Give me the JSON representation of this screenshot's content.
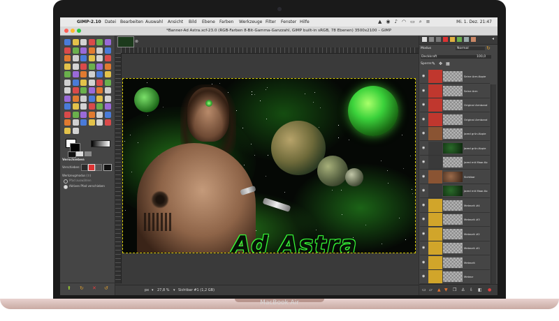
{
  "device": {
    "label": "MacBook Air"
  },
  "menubar": {
    "app_name": "GIMP-2.10",
    "items": [
      "Datei",
      "Bearbeiten",
      "Auswahl",
      "Ansicht",
      "Bild",
      "Ebene",
      "Farben",
      "Werkzeuge",
      "Filter",
      "Fenster",
      "Hilfe"
    ],
    "datetime": "Mi. 1. Dez. 21:47"
  },
  "window": {
    "title": "*Banner-Ad Astra.xcf-23.0 (RGB-Farben 8-Bit-Gamma-Ganzzahl, GIMP built-in sRGB, 78 Ebenen) 3500x2100 – GIMP"
  },
  "toolbox": {
    "options_title": "Verschieben",
    "move_label": "Verschieben:",
    "tool_switch_label": "Werkzeugmodus (⇧)",
    "option_pick": "Pfad auswählen",
    "option_active": "Aktiven Pfad verschieben"
  },
  "status": {
    "unit": "px",
    "zoom": "27,8 %",
    "layer_info": "Sichtbar #1 (1,2 GB)"
  },
  "layers_panel": {
    "mode_label": "Modus",
    "mode_value": "Normal",
    "opacity_label": "Deckkraft",
    "opacity_value": "100,0",
    "lock_label": "Sperre:",
    "layers": [
      {
        "name": "Seine Arm-Kopie",
        "group": "#c0372e"
      },
      {
        "name": "Seine Arm",
        "group": "#c0372e"
      },
      {
        "name": "Original Armband",
        "group": "#c0372e"
      },
      {
        "name": "Original Armband",
        "group": "#c0372e"
      },
      {
        "name": "Jared grün-Kopie",
        "group": "#8a5433"
      },
      {
        "name": "Jared grün-Kopie",
        "group": ""
      },
      {
        "name": "Jared mit Maar-Ko",
        "group": ""
      },
      {
        "name": "Sichtbar",
        "group": "#8a5433"
      },
      {
        "name": "Jared mit Maar-Ko",
        "group": ""
      },
      {
        "name": "Meteorit #4",
        "group": "#d1a52a"
      },
      {
        "name": "Meteorit #3",
        "group": "#d1a52a"
      },
      {
        "name": "Meteorit #2",
        "group": "#d1a52a"
      },
      {
        "name": "Meteorit #1",
        "group": "#d1a52a"
      },
      {
        "name": "Meteorit",
        "group": "#d1a52a"
      },
      {
        "name": "Meteor",
        "group": "#d1a52a"
      }
    ]
  },
  "artwork": {
    "logo_text": "Ad Astra"
  },
  "colors": {
    "accent": "#3bd23b",
    "ui_dark": "#454545",
    "selection": "#d6c900"
  }
}
